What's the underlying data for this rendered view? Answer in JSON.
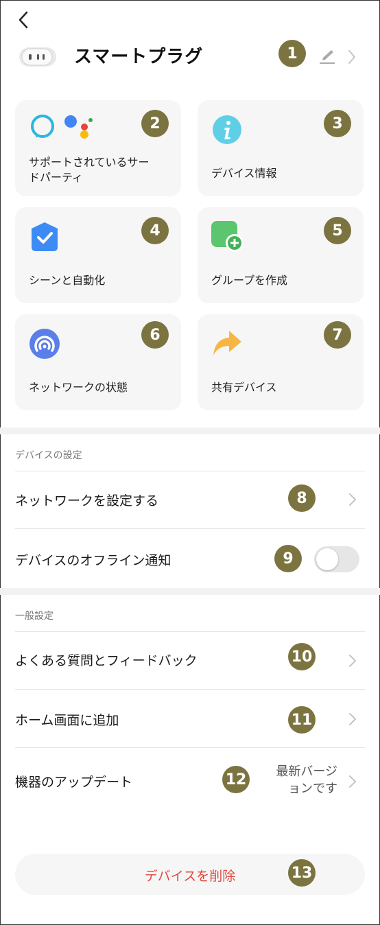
{
  "header": {
    "title": "スマートプラグ",
    "icons": [
      "back-arrow-icon",
      "smart-plug-device-image",
      "pencil-edit-icon",
      "chevron-right-icon"
    ]
  },
  "badges": [
    "1",
    "2",
    "3",
    "4",
    "5",
    "6",
    "7",
    "8",
    "9",
    "10",
    "11",
    "12",
    "13"
  ],
  "cards": [
    {
      "label": "サポートされているサードパーティ",
      "label_line1": "サポートされているサー",
      "label_line2": "ドパーティ",
      "icon": "alexa-google-assistant-icon"
    },
    {
      "label": "デバイス情報",
      "icon": "info-icon"
    },
    {
      "label": "シーンと自動化",
      "icon": "scene-check-icon"
    },
    {
      "label": "グループを作成",
      "icon": "group-add-icon"
    },
    {
      "label": "ネットワークの状態",
      "icon": "network-status-icon"
    },
    {
      "label": "共有デバイス",
      "icon": "share-arrow-icon"
    }
  ],
  "device_settings": {
    "title": "デバイスの設定",
    "network": "ネットワークを設定する",
    "offline_notify": "デバイスのオフライン通知",
    "offline_notify_enabled": false
  },
  "general_settings": {
    "title": "一般設定",
    "faq": "よくある質問とフィードバック",
    "home_screen": "ホーム画面に追加",
    "firmware": "機器のアップデート",
    "firmware_status_line1": "最新バージ",
    "firmware_status_line2": "ョンです"
  },
  "delete_label": "デバイスを削除",
  "colors": {
    "badge": "#7c7440",
    "delete_text": "#e0463c",
    "card_bg": "#f6f6f6",
    "toggle_off": "#e6e6e6"
  }
}
